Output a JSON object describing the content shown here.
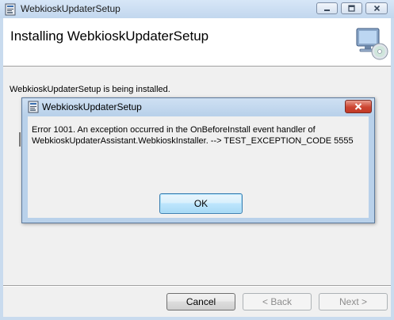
{
  "window": {
    "title": "WebkioskUpdaterSetup",
    "header_title": "Installing WebkioskUpdaterSetup",
    "status": "WebkioskUpdaterSetup is being installed.",
    "buttons": {
      "cancel": "Cancel",
      "back": "< Back",
      "next": "Next >"
    }
  },
  "dialog": {
    "title": "WebkioskUpdaterSetup",
    "message": "Error 1001. An exception occurred in the OnBeforeInstall event handler of WebkioskUpdaterAssistant.WebkioskInstaller. --> TEST_EXCEPTION_CODE 5555",
    "ok_label": "OK"
  },
  "icons": {
    "app": "installer-icon",
    "header": "computer-cd-icon",
    "close": "close-icon"
  },
  "colors": {
    "title_bar": "#c9dbee",
    "dialog_close": "#cc4532",
    "default_button": "#bee6fd"
  }
}
